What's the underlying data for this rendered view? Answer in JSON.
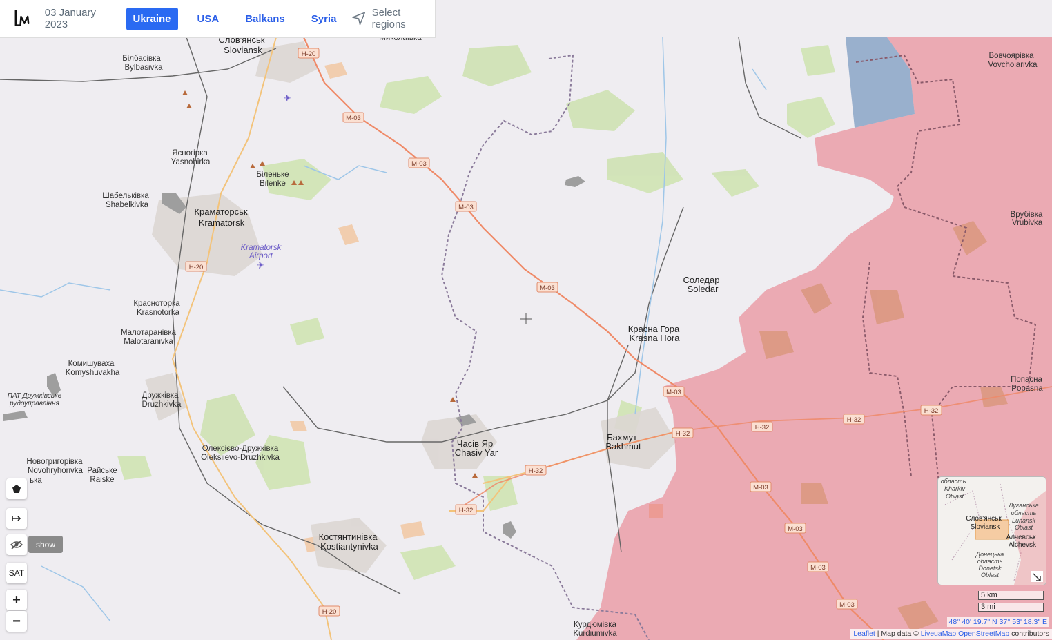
{
  "header": {
    "date": "03 January 2023",
    "tabs": [
      {
        "label": "Ukraine",
        "active": true
      },
      {
        "label": "USA",
        "active": false
      },
      {
        "label": "Balkans",
        "active": false
      },
      {
        "label": "Syria",
        "active": false
      }
    ],
    "select_regions_label": "Select regions"
  },
  "map": {
    "colors": {
      "occupied": "#e8737f",
      "contested": "#8aa4c7",
      "base": "#efedf1",
      "road_major": "#ef8a68",
      "road_minor": "#f3c37a",
      "border": "#8a7a9a"
    },
    "places": [
      {
        "uk": "Слов'янськ",
        "en": "Sloviansk"
      },
      {
        "uk": "Білбасівка",
        "en": "Bylbasivka"
      },
      {
        "uk": "Ясногірка",
        "en": "Yasnohirka"
      },
      {
        "uk": "Біленьке",
        "en": "Bilenke"
      },
      {
        "uk": "Шабельківка",
        "en": "Shabelkivka"
      },
      {
        "uk": "Краматорськ",
        "en": "Kramatorsk"
      },
      {
        "uk": "Kramatorsk",
        "en": "Airport"
      },
      {
        "uk": "Красноторка",
        "en": "Krasnotorka"
      },
      {
        "uk": "Малотаранівка",
        "en": "Malotaranivka"
      },
      {
        "uk": "Комишуваха",
        "en": "Komyshuvakha"
      },
      {
        "uk": "ПАТ Дружківське",
        "en": "рудоуправління"
      },
      {
        "uk": "Дружківка",
        "en": "Druzhkivka"
      },
      {
        "uk": "Новогригорівка",
        "en": "Novohryhorivka"
      },
      {
        "uk": "Райське",
        "en": "Raiske"
      },
      {
        "uk": "Олексієво-Дружківка",
        "en": "Oleksiievo-Druzhkivka"
      },
      {
        "uk": "Костянтинівка",
        "en": "Kostiantynivka"
      },
      {
        "uk": "Часів Яр",
        "en": "Chasiv Yar"
      },
      {
        "uk": "Бахмут",
        "en": "Bakhmut"
      },
      {
        "uk": "Красна Гора",
        "en": "Krasna Hora"
      },
      {
        "uk": "Соледар",
        "en": "Soledar"
      },
      {
        "uk": "Вовчоярівка",
        "en": "Vovchoiarivka"
      },
      {
        "uk": "Врубівка",
        "en": "Vrubivka"
      },
      {
        "uk": "Попасна",
        "en": "Popasna"
      },
      {
        "uk": "Курдюмівка",
        "en": "Kurdiumivka"
      }
    ],
    "road_labels": [
      "H-20",
      "M-03",
      "H-32"
    ],
    "partial_label": "Миколаївка",
    "extra_label": "ька"
  },
  "controls": {
    "polygon_icon": "pentagon-icon",
    "measure_icon": "arrow-right-bar-icon",
    "hide_icon": "eye-slash-icon",
    "show_label": "show",
    "sat_label": "SAT",
    "zoom_in": "+",
    "zoom_out": "−"
  },
  "minimap": {
    "labels": [
      {
        "uk": "область",
        "en": "Kharkiv",
        "extra": "Oblast"
      },
      {
        "uk": "Луганська",
        "en": "область",
        "extra": "Luhansk",
        "extra2": "Oblast"
      },
      {
        "uk": "Слов'янськ",
        "en": "Sloviansk"
      },
      {
        "uk": "Алчевськ",
        "en": "Alchevsk"
      },
      {
        "uk": "Донецька",
        "en": "область",
        "extra": "Donetsk",
        "extra2": "Oblast"
      }
    ]
  },
  "scale": {
    "km": "5 km",
    "mi": "3 mi"
  },
  "coordinates": "48° 40' 19.7\" N 37° 53' 18.3\" E",
  "attribution": {
    "leaflet": "Leaflet",
    "sep": " | Map data © ",
    "liveua": "LiveuaMap",
    "osm": "OpenStreetMap",
    "tail": " contributors"
  }
}
